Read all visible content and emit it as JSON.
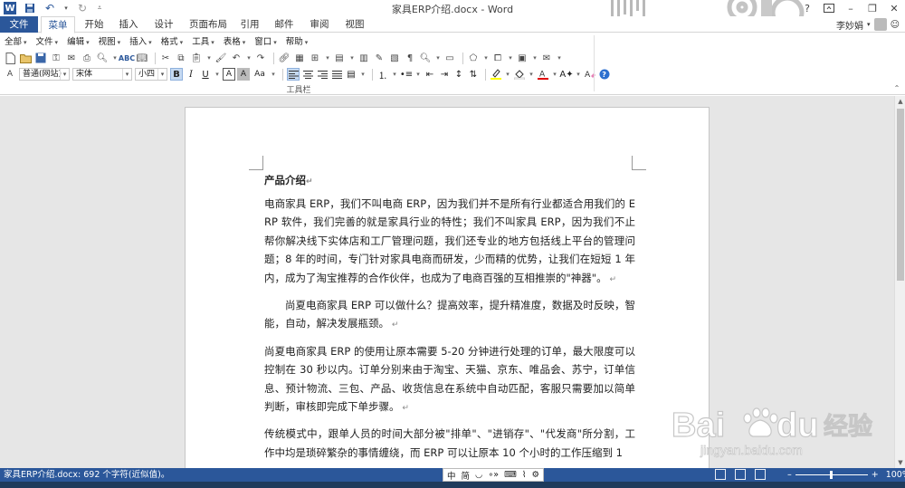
{
  "titlebar": {
    "title": "家具ERP介绍.docx - Word",
    "app_letter": "W"
  },
  "tabs": [
    {
      "label": "文件",
      "active": false
    },
    {
      "label": "菜单",
      "active": true
    },
    {
      "label": "开始"
    },
    {
      "label": "插入"
    },
    {
      "label": "设计"
    },
    {
      "label": "页面布局"
    },
    {
      "label": "引用"
    },
    {
      "label": "邮件"
    },
    {
      "label": "审阅"
    },
    {
      "label": "视图"
    }
  ],
  "user": {
    "name": "李妙娟"
  },
  "menubar": [
    {
      "label": "全部"
    },
    {
      "label": "文件"
    },
    {
      "label": "编辑"
    },
    {
      "label": "视图"
    },
    {
      "label": "插入"
    },
    {
      "label": "格式"
    },
    {
      "label": "工具"
    },
    {
      "label": "表格"
    },
    {
      "label": "窗口"
    },
    {
      "label": "帮助"
    }
  ],
  "format": {
    "style": "普通(网站)",
    "font": "宋体",
    "size": "小四"
  },
  "ribbon": {
    "group_label": "工具栏"
  },
  "document": {
    "heading": "产品介绍",
    "paragraphs": [
      {
        "text": "电商家具 ERP，我们不叫电商 ERP，因为我们并不是所有行业都适合用我们的 ERP 软件，我们完善的就是家具行业的特性；我们不叫家具 ERP，因为我们不止帮你解决线下实体店和工厂管理问题，我们还专业的地方包括线上平台的管理问题；8 年的时间，专门针对家具电商而研发，少而精的优势，让我们在短短 1 年内，成为了淘宝推荐的合作伙伴，也成为了电商百强的互相推崇的\"神器\"。",
        "indent": false
      },
      {
        "text": "尚夏电商家具 ERP 可以做什么？提高效率，提升精准度，数据及时反映，智能，自动，解决发展瓶颈。",
        "indent": true
      },
      {
        "text": "尚夏电商家具 ERP 的使用让原本需要 5-20 分钟进行处理的订单，最大限度可以控制在 30 秒以内。订单分别来由于淘宝、天猫、京东、唯品会、苏宁，订单信息、预计物流、三包、产品、收货信息在系统中自动匹配，客服只需要加以简单判断，审核即完成下单步骤。",
        "indent": false
      },
      {
        "text": "传统模式中，跟单人员的时间大部分被\"排单\"、\"进销存\"、\"代发商\"所分割，工作中均是琐碎繁杂的事情缠绕，而 ERP 可以让原本 10 个小时的工作压缩到 1",
        "indent": false
      }
    ]
  },
  "status": {
    "text": "家具ERP介绍.docx: 692 个字符(近似值)。",
    "ime": [
      "中",
      "简",
      "◡",
      "∘»",
      "⌨",
      "⌇",
      "⚙"
    ],
    "zoom": "100%"
  },
  "watermark": {
    "brand": "Bai",
    "brand2": "du",
    "cn": "经验",
    "url": "jingyan.baidu.com"
  }
}
